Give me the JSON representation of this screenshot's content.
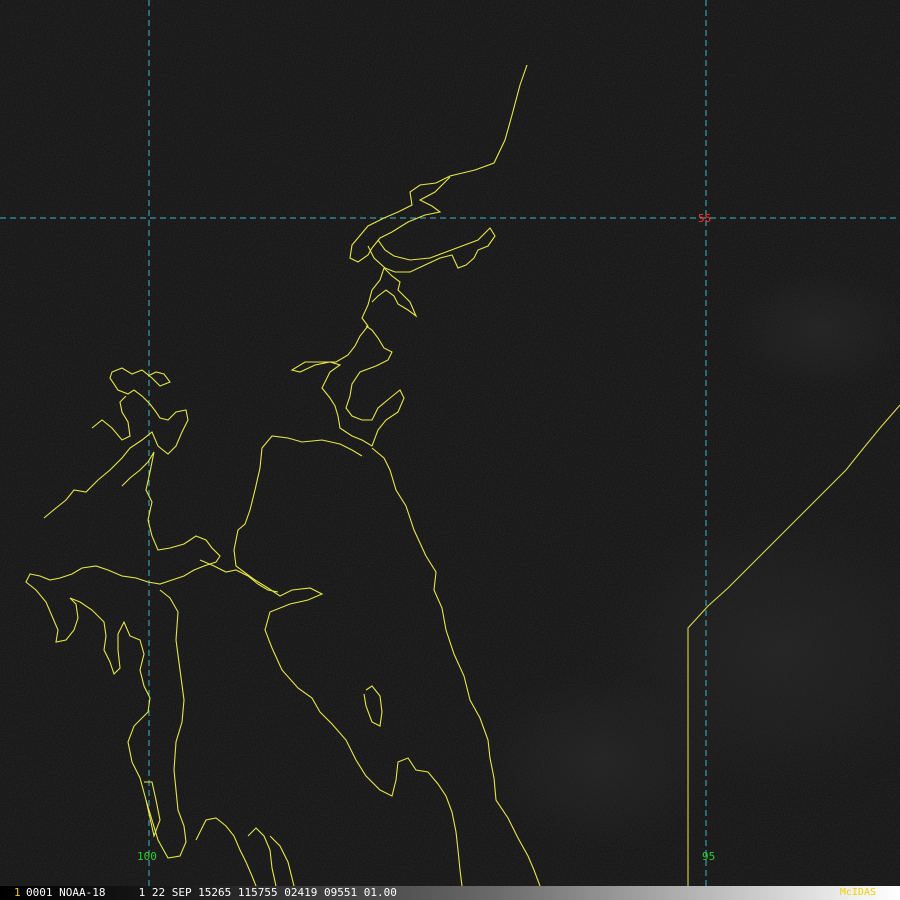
{
  "image": {
    "satellite": "NOAA-18"
  },
  "grid": {
    "latitude_labels": [
      {
        "value": "55",
        "color": "#ff3030"
      }
    ],
    "longitude_labels": [
      {
        "value": "100",
        "color": "#30d030"
      },
      {
        "value": "95",
        "color": "#30d030"
      }
    ]
  },
  "status_bar": {
    "frame_index": "1",
    "text": "0001 NOAA-18     1 22 SEP 15265 115755 02419 09551 01.00",
    "brand": "McIDAS"
  }
}
